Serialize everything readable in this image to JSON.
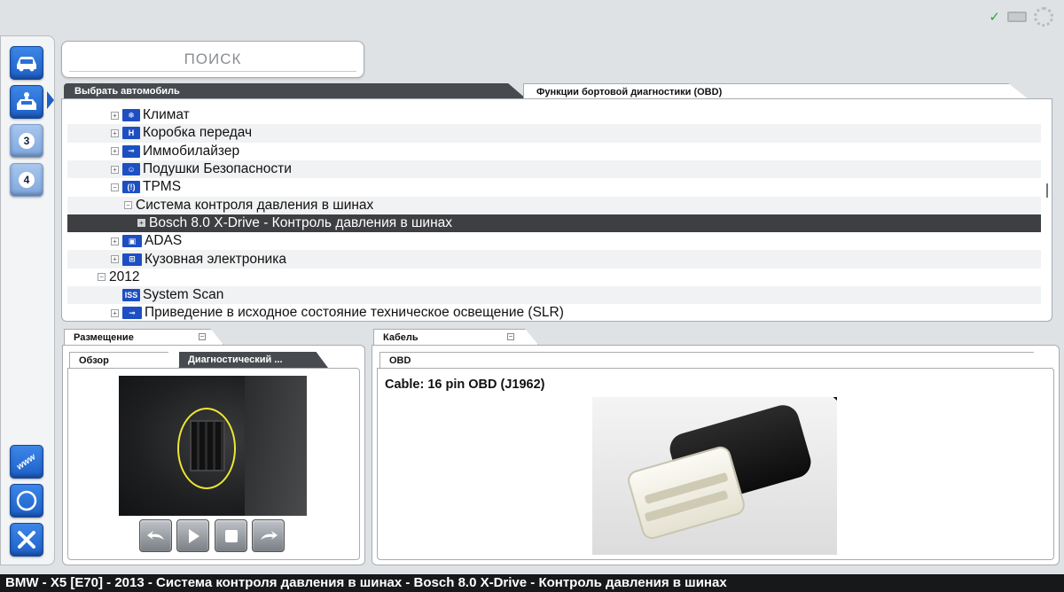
{
  "search": {
    "label": "ПОИСК"
  },
  "tabs": {
    "select_vehicle": "Выбрать автомобиль",
    "obd_functions": "Функции бортовой диагностики (OBD)"
  },
  "tree": [
    {
      "label": "Климат",
      "icon": "climate-icon",
      "icon_text": "❄"
    },
    {
      "label": "Коробка передач",
      "icon": "gearbox-icon",
      "icon_text": "H"
    },
    {
      "label": "Иммобилайзер",
      "icon": "key-icon",
      "icon_text": "⊸"
    },
    {
      "label": "Подушки Безопасности",
      "icon": "airbag-icon",
      "icon_text": "☺"
    },
    {
      "label": "TPMS",
      "icon": "tpms-icon",
      "icon_text": "(!)"
    },
    {
      "label": "Система контроля давления в шинах"
    },
    {
      "label": "Bosch 8.0 X-Drive - Контроль давления в шинах"
    },
    {
      "label": "ADAS",
      "icon": "adas-icon",
      "icon_text": "▣"
    },
    {
      "label": "Кузовная электроника",
      "icon": "body-electronics-icon",
      "icon_text": "⊞"
    },
    {
      "label": "2012"
    },
    {
      "label": "System Scan",
      "icon": "iss-icon",
      "icon_text": "ISS"
    },
    {
      "label": "Приведение в исходное состояние техническое освещение (SLR)",
      "icon": "slr-icon",
      "icon_text": "⊸"
    }
  ],
  "placement": {
    "title": "Размещение",
    "tab_overview": "Обзор",
    "tab_diagnostic": "Диагностический ..."
  },
  "cable": {
    "title": "Кабель",
    "tab_obd": "OBD",
    "description": "Cable: 16 pin OBD (J1962)"
  },
  "left_toolbar": {
    "step3": "3",
    "step4": "4",
    "www": "www"
  },
  "status_bar": {
    "text": "BMW - X5 [E70] - 2013 - Система контроля давления в шинах - Bosch 8.0 X-Drive - Контроль давления в шинах"
  },
  "colors": {
    "accent_blue": "#1d5fc7",
    "selected_row": "#3d3f42",
    "highlight_circle": "#f0e631"
  }
}
